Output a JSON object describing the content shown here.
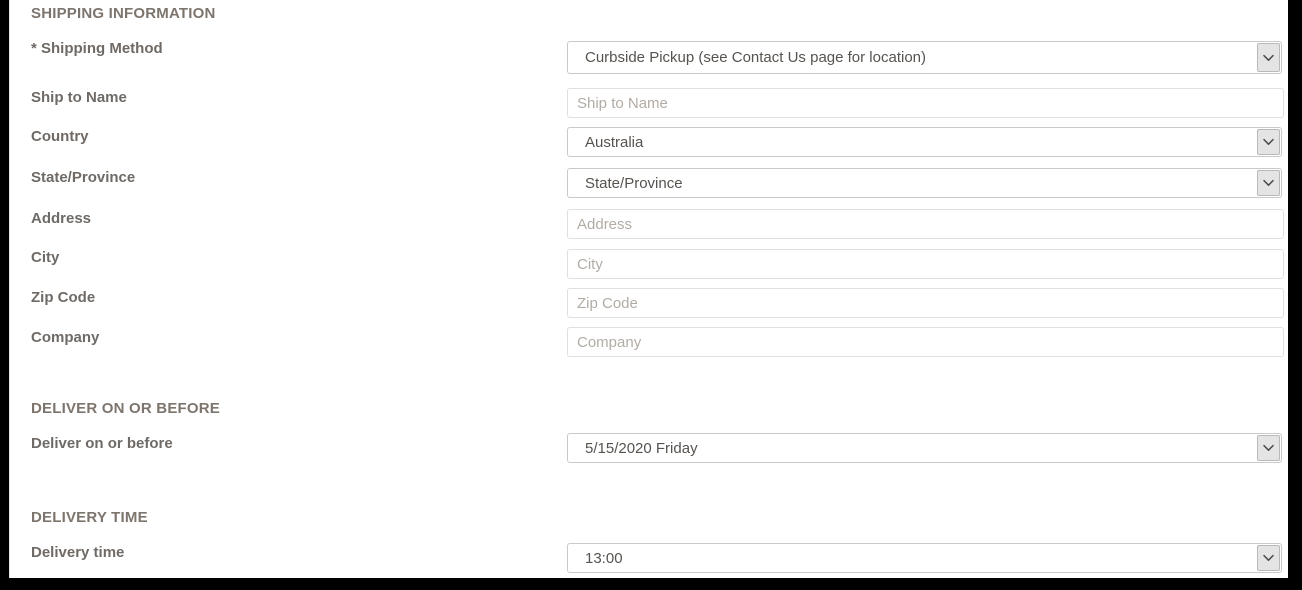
{
  "sections": [
    {
      "id": "shipping-information",
      "header": "SHIPPING INFORMATION",
      "fields": [
        {
          "name": "shipping-method",
          "label": "* Shipping Method",
          "type": "select",
          "value": "Curbside Pickup (see Contact Us page for location)"
        },
        {
          "name": "ship-to-name",
          "label": "Ship to Name",
          "type": "text",
          "value": "",
          "placeholder": "Ship to Name"
        },
        {
          "name": "country",
          "label": "Country",
          "type": "select",
          "value": "Australia"
        },
        {
          "name": "state-province",
          "label": "State/Province",
          "type": "select",
          "value": "State/Province"
        },
        {
          "name": "address",
          "label": "Address",
          "type": "text",
          "value": "",
          "placeholder": "Address"
        },
        {
          "name": "city",
          "label": "City",
          "type": "text",
          "value": "",
          "placeholder": "City"
        },
        {
          "name": "zip-code",
          "label": "Zip Code",
          "type": "text",
          "value": "",
          "placeholder": "Zip Code"
        },
        {
          "name": "company",
          "label": "Company",
          "type": "text",
          "value": "",
          "placeholder": "Company"
        }
      ]
    },
    {
      "id": "deliver-on-or-before",
      "header": "DELIVER ON OR BEFORE",
      "fields": [
        {
          "name": "deliver-on-or-before",
          "label": "Deliver on or before",
          "type": "select",
          "value": "5/15/2020 Friday"
        }
      ]
    },
    {
      "id": "delivery-time",
      "header": "DELIVERY TIME",
      "fields": [
        {
          "name": "delivery-time",
          "label": "Delivery time",
          "type": "select",
          "value": "13:00"
        }
      ]
    }
  ],
  "icons": {
    "dropdown": "chevron-down-icon"
  },
  "colors": {
    "label": "#6f6a66",
    "section_header": "#7d756d",
    "value_text": "#57534f",
    "placeholder_text": "#b2aca6",
    "select_border": "#c9c9c9",
    "input_border": "#e0e0e0",
    "arrow_button": "#e4e4e4",
    "page_background": "#ffffff",
    "chrome": "#000000"
  },
  "layout": {
    "section_header_tops": [
      5,
      400,
      509
    ],
    "label_tops": [
      40,
      89,
      128,
      169,
      210,
      249,
      289,
      329,
      435,
      544
    ],
    "control_tops": [
      41,
      88,
      127,
      168,
      209,
      249,
      288,
      327,
      433,
      543
    ]
  }
}
